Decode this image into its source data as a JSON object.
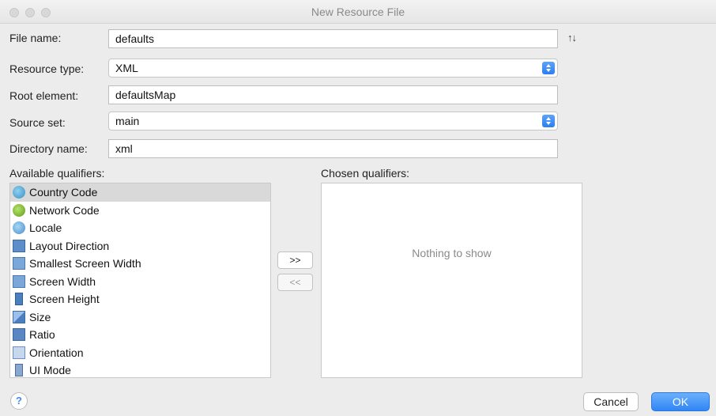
{
  "window": {
    "title": "New Resource File"
  },
  "form": {
    "file_name_label": "File name:",
    "file_name_value": "defaults",
    "resource_type_label": "Resource type:",
    "resource_type_value": "XML",
    "root_element_label": "Root element:",
    "root_element_value": "defaultsMap",
    "source_set_label": "Source set:",
    "source_set_value": "main",
    "directory_name_label": "Directory name:",
    "directory_name_value": "xml"
  },
  "qualifiers": {
    "available_label": "Available qualifiers:",
    "chosen_label": "Chosen qualifiers:",
    "available": [
      {
        "label": "Country Code",
        "icon": "globe-icon",
        "selected": true
      },
      {
        "label": "Network Code",
        "icon": "network-icon"
      },
      {
        "label": "Locale",
        "icon": "locale-icon"
      },
      {
        "label": "Layout Direction",
        "icon": "layout-direction-icon"
      },
      {
        "label": "Smallest Screen Width",
        "icon": "smallest-width-icon"
      },
      {
        "label": "Screen Width",
        "icon": "screen-width-icon"
      },
      {
        "label": "Screen Height",
        "icon": "screen-height-icon"
      },
      {
        "label": "Size",
        "icon": "size-icon"
      },
      {
        "label": "Ratio",
        "icon": "ratio-icon"
      },
      {
        "label": "Orientation",
        "icon": "orientation-icon"
      },
      {
        "label": "UI Mode",
        "icon": "ui-mode-icon"
      }
    ],
    "add_label": ">>",
    "remove_label": "<<",
    "empty_text": "Nothing to show"
  },
  "footer": {
    "help_label": "?",
    "cancel_label": "Cancel",
    "ok_label": "OK"
  }
}
